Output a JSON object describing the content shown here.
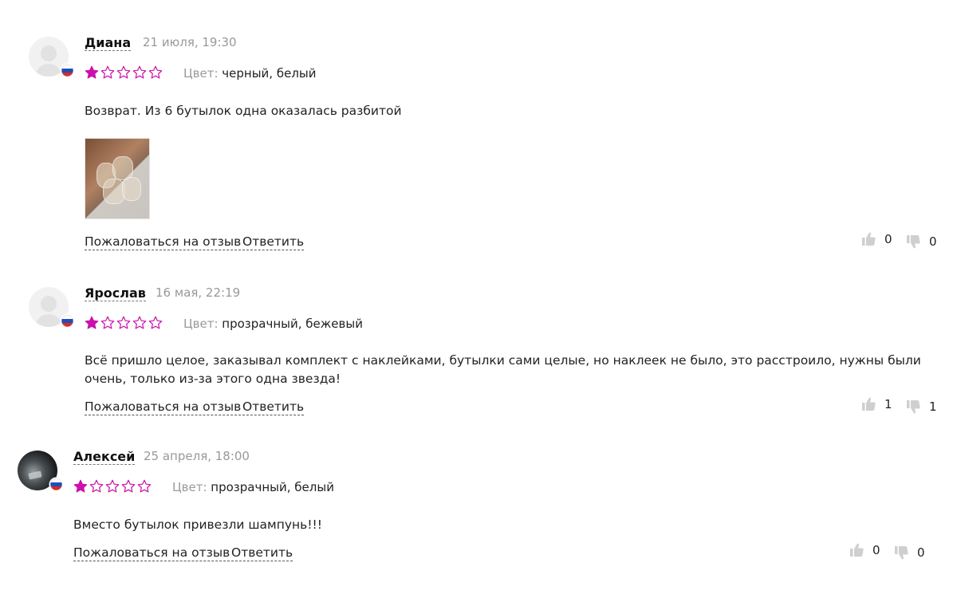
{
  "reviews": [
    {
      "author": "Диана",
      "date": "21 июля, 19:30",
      "rating": 1,
      "max_rating": 5,
      "color_label": "Цвет:",
      "color_value": "черный, белый",
      "text": "Возврат. Из 6 бутылок одна оказалась разбитой",
      "has_photo": true,
      "avatar": "default-avatar",
      "flag": "russia-flag-icon",
      "complain_label": "Пожаловаться на отзыв",
      "reply_label": "Ответить",
      "likes": "0",
      "dislikes": "0"
    },
    {
      "author": "Ярослав",
      "date": "16 мая, 22:19",
      "rating": 1,
      "max_rating": 5,
      "color_label": "Цвет:",
      "color_value": "прозрачный, бежевый",
      "text": "Всё пришло целое, заказывал комплект с наклейками, бутылки сами целые, но наклеек не было, это расстроило, нужны были очень, только из-за этого одна звезда!",
      "has_photo": false,
      "avatar": "default-avatar",
      "flag": "russia-flag-icon",
      "complain_label": "Пожаловаться на отзыв",
      "reply_label": "Ответить",
      "likes": "1",
      "dislikes": "1"
    },
    {
      "author": "Алексей",
      "date": "25 апреля, 18:00",
      "rating": 1,
      "max_rating": 5,
      "color_label": "Цвет:",
      "color_value": "прозрачный, белый",
      "text": "Вместо бутылок привезли шампунь!!!",
      "has_photo": false,
      "avatar": "photo-avatar",
      "flag": "russia-flag-icon",
      "complain_label": "Пожаловаться на отзыв",
      "reply_label": "Ответить",
      "likes": "0",
      "dislikes": "0"
    }
  ],
  "colors": {
    "star_accent": "#cb11ab",
    "muted_text": "#999999",
    "vote_icon": "#cfcfcf"
  }
}
